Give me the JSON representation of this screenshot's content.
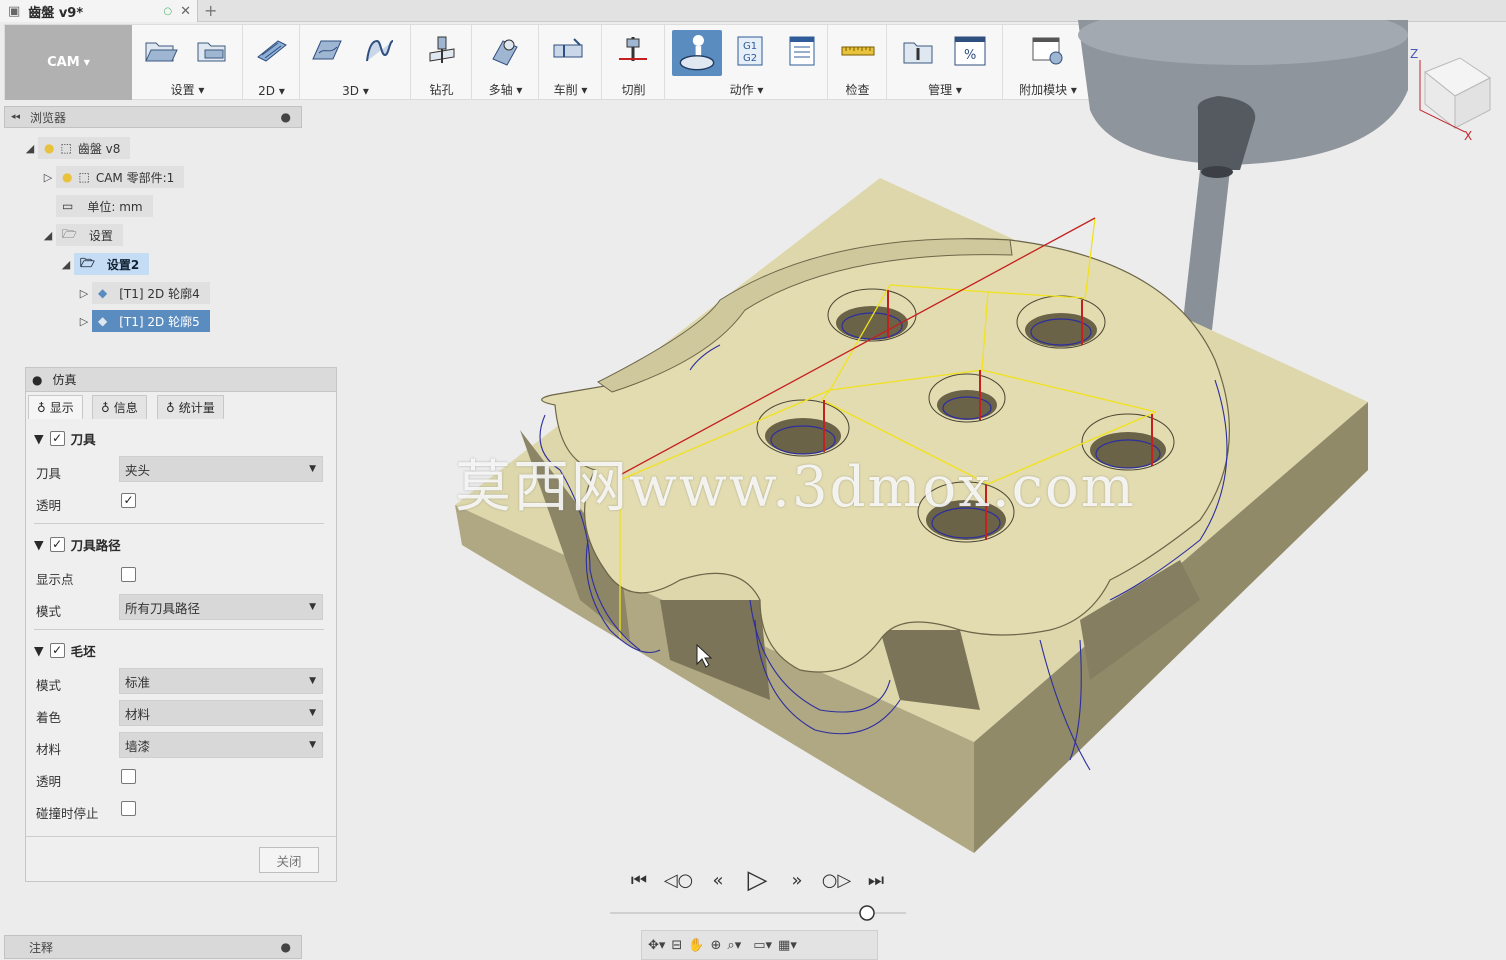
{
  "window": {
    "doc_title": "齒盤 v9*"
  },
  "toolbar": {
    "workspace": "CAM",
    "groups": [
      {
        "label": "设置"
      },
      {
        "label": "2D"
      },
      {
        "label": "3D"
      },
      {
        "label": "钻孔"
      },
      {
        "label": "多轴"
      },
      {
        "label": "车削"
      },
      {
        "label": "切削"
      },
      {
        "label": "动作"
      },
      {
        "label": "检查"
      },
      {
        "label": "管理"
      },
      {
        "label": "附加模块"
      }
    ],
    "g1g2_text": "G1\nG2",
    "percent_text": "%"
  },
  "browser": {
    "title": "浏览器",
    "items": [
      {
        "label": "齒盤 v8"
      },
      {
        "label": "CAM 零部件:1"
      },
      {
        "label": "单位: mm"
      },
      {
        "label": "设置"
      },
      {
        "label": "设置2"
      },
      {
        "label": "[T1] 2D 轮廓4"
      },
      {
        "label": "[T1] 2D 轮廓5"
      }
    ]
  },
  "simulation": {
    "title": "仿真",
    "tabs": [
      "显示",
      "信息",
      "统计量"
    ],
    "tool_section": {
      "label": "刀具",
      "checked": true,
      "tool_label": "刀具",
      "tool_value": "夹头",
      "transparent_label": "透明",
      "transparent_checked": true
    },
    "toolpath_section": {
      "label": "刀具路径",
      "checked": true,
      "show_points_label": "显示点",
      "show_points_checked": false,
      "mode_label": "模式",
      "mode_value": "所有刀具路径"
    },
    "stock_section": {
      "label": "毛坯",
      "checked": true,
      "mode_label": "模式",
      "mode_value": "标准",
      "color_label": "着色",
      "color_value": "材料",
      "material_label": "材料",
      "material_value": "墙漆",
      "transparent_label": "透明",
      "transparent_checked": false,
      "stop_label": "碰撞时停止",
      "stop_checked": false
    },
    "close_label": "关闭"
  },
  "notes": {
    "label": "注释"
  },
  "viewcube": {
    "axis_z": "Z",
    "axis_x": "X"
  },
  "watermark": "莫西网www.3dmox.com",
  "playback": {
    "slider_position": 1.0
  },
  "colors": {
    "stock": "#d9d3a6",
    "stock_dark": "#a8a07c",
    "toolpath_blue": "#2c2ea0",
    "rapid_yellow": "#f0e21c",
    "lead_red": "#c42020"
  }
}
